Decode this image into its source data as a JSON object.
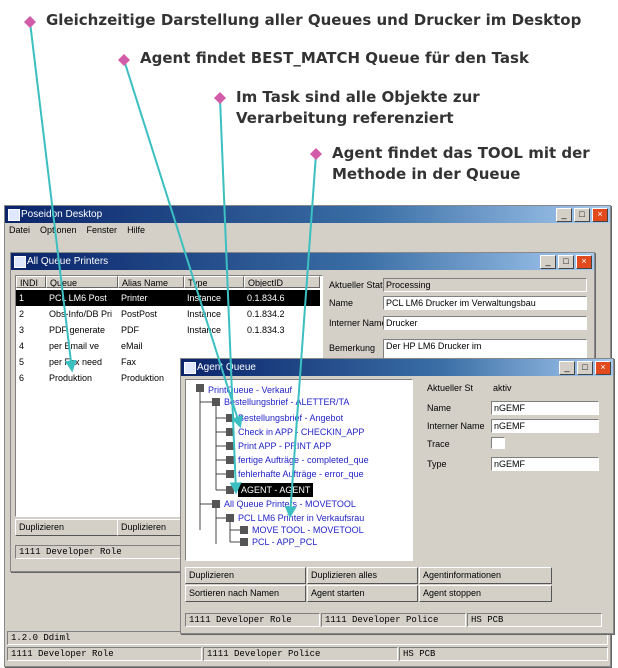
{
  "annotations": [
    "Gleichzeitige Darstellung aller Queues und Drucker im Desktop",
    "Agent findet BEST_MATCH Queue für den Task",
    "Im Task sind alle Objekte zur",
    "Verarbeitung referenziert",
    "Agent findet das TOOL mit der",
    "Methode in der Queue"
  ],
  "colors": {
    "diamond": "#d35ca8",
    "arrow": "#3bbfc0",
    "titlebar": "#0a246a"
  },
  "desktop": {
    "title": "Poseidon Desktop",
    "menu": [
      "Datei",
      "Optionen",
      "Fenster",
      "Hilfe"
    ]
  },
  "queues": {
    "title": "All Queue Printers",
    "columns": [
      "INDI",
      "Queue",
      "Alias Name",
      "Type",
      "ObjectID"
    ],
    "rows": [
      [
        "1",
        "PCL LM6 Post",
        "Printer",
        "Instance",
        "0.1.834.6"
      ],
      [
        "2",
        "Obs-Info/DB Pri",
        "PostPost",
        "Instance",
        "0.1.834.2"
      ],
      [
        "3",
        "PDF generate",
        "PDF",
        "Instance",
        "0.1.834.3"
      ],
      [
        "4",
        "per Email ve",
        "eMail",
        "",
        ""
      ],
      [
        "5",
        "per Fax need",
        "Fax",
        "",
        ""
      ],
      [
        "6",
        "Produktion",
        "Produktion",
        "",
        ""
      ]
    ],
    "status_header": "Aktueller Status",
    "status_value": "Processing",
    "fields": [
      {
        "label": "Name",
        "value": "PCL LM6 Drucker im Verwaltungsbau"
      },
      {
        "label": "Interner Name",
        "value": "Drucker"
      },
      {
        "label": "Bemerkung",
        "value": "Der HP LM6 Drucker im"
      }
    ],
    "btn_duplicate": "Duplizieren",
    "btn_duplicate2": "Duplizieren",
    "status": "1111 Developer Role"
  },
  "agent": {
    "title": "Agent Queue",
    "tree": [
      "PrintQueue - Verkauf",
      "Bestellungsbrief - ALETTER/TA",
      "Bestellungsbrief - Angebot",
      "Check in APP - CHECKIN_APP",
      "Print APP - PRINT APP",
      "fertige Aufträge - completed_que",
      "fehlerhafte Aufträge - error_que",
      "AGENT - AGENT",
      "All Queue Printers - MOVETOOL",
      "PCL LM6 Printer in Verkaufsrau",
      "MOVE TOOL - MOVETOOL",
      "PCL - APP_PCL"
    ],
    "status_label": "Aktueller St",
    "status_value": "aktiv",
    "fields": [
      {
        "label": "Name",
        "value": "nGEMF"
      },
      {
        "label": "Interner Name",
        "value": "nGEMF"
      },
      {
        "label": "Trace",
        "value": ""
      },
      {
        "label": "Type",
        "value": "nGEMF"
      }
    ],
    "buttons": [
      "Duplizieren",
      "Duplizieren alles",
      "Agentinformationen",
      "Sortieren nach Namen",
      "Agent starten",
      "Agent stoppen"
    ],
    "status": [
      "1111 Developer Role",
      "1111 Developer Police",
      "HS PCB"
    ]
  },
  "bottom": {
    "row1": "1.2.0 Ddiml",
    "status": [
      "1111 Developer Role",
      "1111 Developer Police",
      "HS PCB"
    ]
  }
}
